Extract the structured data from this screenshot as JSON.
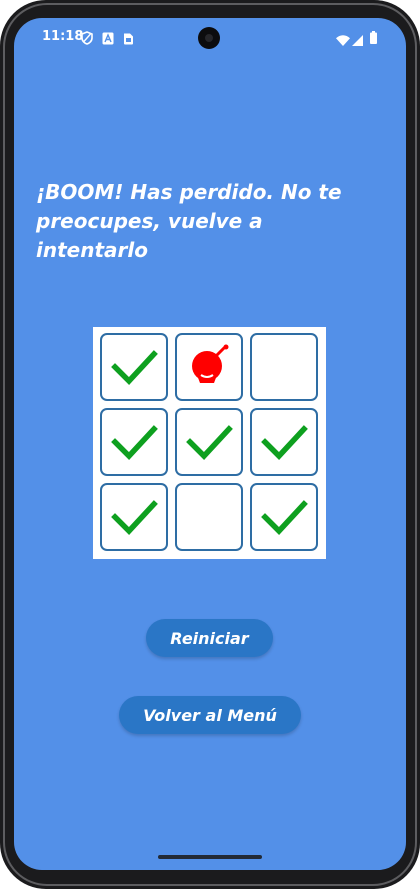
{
  "status_bar": {
    "time": "11:18",
    "left_icons": [
      "shield-icon",
      "a-square-icon",
      "sim-card-icon"
    ],
    "right_icons": [
      "wifi-icon",
      "signal-icon",
      "battery-icon"
    ]
  },
  "game": {
    "message": "¡BOOM! Has perdido. No te preocupes, vuelve a intentarlo",
    "board": [
      [
        "check",
        "bomb",
        "empty"
      ],
      [
        "check",
        "check",
        "check"
      ],
      [
        "check",
        "empty",
        "check"
      ]
    ]
  },
  "buttons": {
    "restart_label": "Reiniciar",
    "menu_label": "Volver al Menú"
  },
  "colors": {
    "background": "#5390e8",
    "button": "#2a76c6",
    "check": "#0ea01f",
    "bomb": "#ff0000",
    "cell_border": "#2e6da4"
  }
}
